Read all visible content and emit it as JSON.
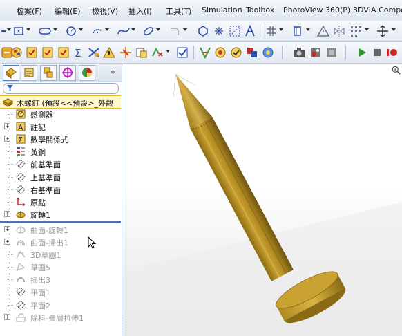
{
  "menu": {
    "items": [
      "檔案(F)",
      "編輯(E)",
      "檢視(V)",
      "插入(I)",
      "工具(T)",
      "Simulation",
      "Toolbox",
      "PhotoView 360(P)",
      "3DVIA Compos"
    ]
  },
  "toolbar1": {
    "icons": [
      "line-tool-icon",
      "rectangle-tool-icon",
      "slot-tool-icon",
      "circle-tool-icon",
      "arc-tool-icon",
      "spline-tool-icon",
      "ellipse-tool-icon",
      "fillet-sketch-icon",
      "polygon-tool-icon",
      "point-tool-icon",
      "construction-geometry-icon",
      "text-tool-icon",
      "trim-entities-icon",
      "convert-entities-icon",
      "offset-entities-icon",
      "mirror-entities-icon",
      "linear-pattern-icon",
      "move-entities-icon"
    ]
  },
  "toolbar2": {
    "icons": [
      "smart-dimension-icon",
      "relations-icon",
      "checkbox-icon",
      "checkbox-icon",
      "equations-icon",
      "mass-properties-icon",
      "warning-icon",
      "section-icon",
      "copy-icon",
      "import-icon",
      "check-icon",
      "sim-icon",
      "rendering-icon",
      "check-circle-icon",
      "appearance-icon",
      "color-icon",
      "camera-icon",
      "photoview-icon",
      "render-settings-icon",
      "play-icon",
      "stop-icon",
      "record-icon"
    ]
  },
  "panel": {
    "tabs": [
      "feature-manager-tab",
      "property-manager-tab",
      "configuration-manager-tab",
      "dimxpert-tab",
      "display-manager-tab"
    ],
    "expand_label": "»",
    "root_label": "木螺釘 (預設<<預設>_外觀",
    "tree": [
      {
        "label": "感測器",
        "icon": "sensor-icon",
        "expand": false,
        "dim": false
      },
      {
        "label": "註記",
        "icon": "annotation-icon",
        "expand": true,
        "dim": false
      },
      {
        "label": "數學關係式",
        "icon": "equations-icon",
        "expand": true,
        "dim": false
      },
      {
        "label": "黃銅",
        "icon": "material-icon",
        "expand": false,
        "dim": false
      },
      {
        "label": "前基準面",
        "icon": "plane-icon",
        "expand": false,
        "dim": false
      },
      {
        "label": "上基準面",
        "icon": "plane-icon",
        "expand": false,
        "dim": false
      },
      {
        "label": "右基準面",
        "icon": "plane-icon",
        "expand": false,
        "dim": false
      },
      {
        "label": "原點",
        "icon": "origin-icon",
        "expand": false,
        "dim": false
      },
      {
        "label": "旋轉1",
        "icon": "revolve-icon",
        "expand": true,
        "dim": false
      },
      {
        "label": "曲面-旋轉1",
        "icon": "surface-revolve-icon",
        "expand": true,
        "dim": true
      },
      {
        "label": "曲面-掃出1",
        "icon": "surface-sweep-icon",
        "expand": true,
        "dim": true
      },
      {
        "label": "3D草圖1",
        "icon": "sketch3d-icon",
        "expand": false,
        "dim": true
      },
      {
        "label": "草圖5",
        "icon": "sketch-icon",
        "expand": false,
        "dim": true
      },
      {
        "label": "掃出3",
        "icon": "sweep-icon",
        "expand": false,
        "dim": true
      },
      {
        "label": "平面1",
        "icon": "plane-icon",
        "expand": false,
        "dim": true
      },
      {
        "label": "平面2",
        "icon": "plane-icon",
        "expand": false,
        "dim": true
      },
      {
        "label": "除料-疊層拉伸1",
        "icon": "loft-cut-icon",
        "expand": true,
        "dim": true
      }
    ]
  },
  "colors": {
    "brass": "#b8912a",
    "brass_dark": "#6f5614",
    "brass_light": "#d8b44a",
    "selection": "#fff6c9"
  }
}
